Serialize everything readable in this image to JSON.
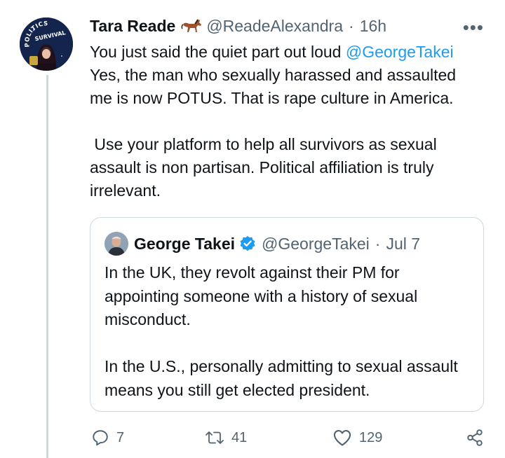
{
  "tweet": {
    "author_name": "Tara Reade",
    "author_handle": "@ReadeAlexandra",
    "separator": "·",
    "time": "16h",
    "more_label": "•••",
    "text_intro": "You just said the quiet part out loud ",
    "mention": "@GeorgeTakei",
    "text_rest": "\nYes, the man who sexually harassed and assaulted me is now POTUS. That is rape culture in America.\n\n Use your platform to help all survivors as sexual assault is non partisan. Political affiliation is truly irrelevant.",
    "avatar_text": [
      "POLITICS",
      "SURVIVAL"
    ]
  },
  "quoted_tweet": {
    "author_name": "George Takei",
    "author_handle": "@GeorgeTakei",
    "separator": "·",
    "date": "Jul 7",
    "text": "In the UK, they revolt against their PM for appointing someone with a history of sexual misconduct.\n\nIn the U.S., personally admitting to sexual assault means you still get elected president."
  },
  "actions": {
    "reply_count": "7",
    "retweet_count": "41",
    "like_count": "129"
  },
  "colors": {
    "link": "#1d9bf0",
    "secondary": "#536471",
    "border": "#cfd9de"
  },
  "icons": [
    "horse-emoji-icon",
    "more-icon",
    "verified-badge-icon",
    "reply-icon",
    "retweet-icon",
    "like-icon",
    "share-icon"
  ]
}
